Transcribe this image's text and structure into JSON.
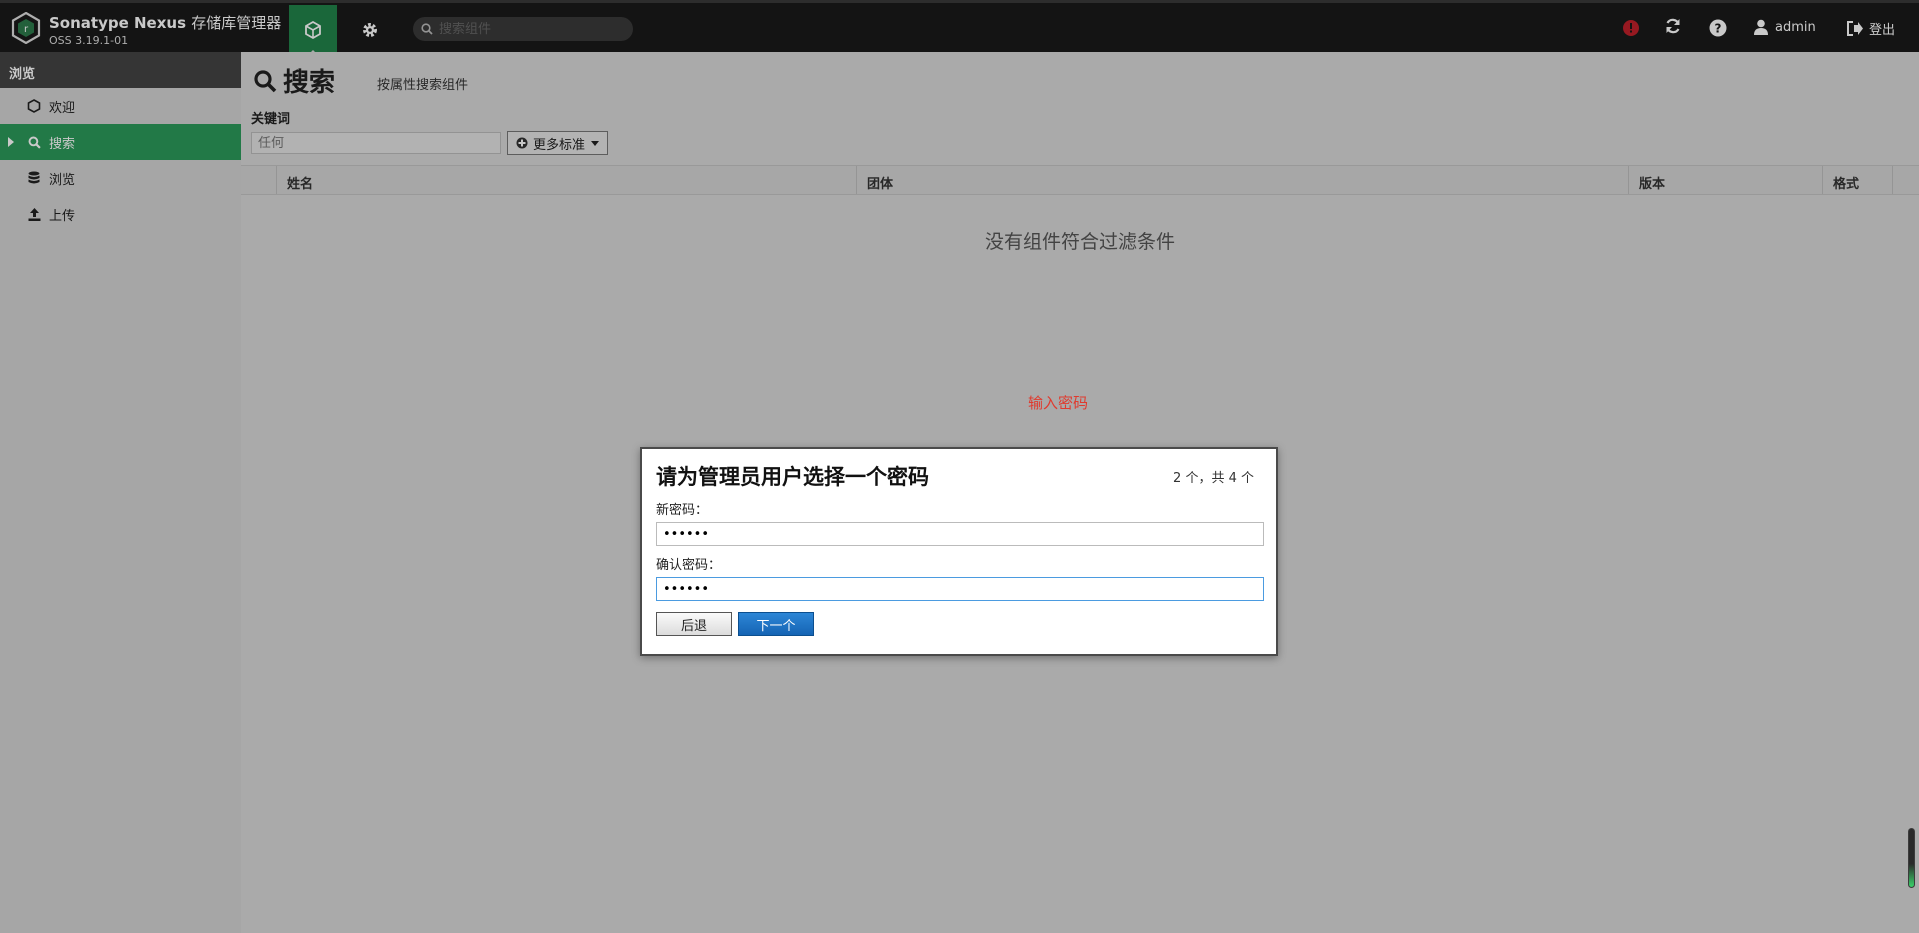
{
  "app": {
    "name": "Sonatype Nexus",
    "name_cn": "存储库管理器",
    "version": "OSS 3.19.1-01"
  },
  "topbar": {
    "search_placeholder": "搜索组件",
    "user": "admin",
    "logout": "登出"
  },
  "sidebar": {
    "header": "浏览",
    "items": [
      {
        "label": "欢迎",
        "icon": "hexagon-icon"
      },
      {
        "label": "搜索",
        "icon": "search-icon"
      },
      {
        "label": "浏览",
        "icon": "database-icon"
      },
      {
        "label": "上传",
        "icon": "upload-icon"
      }
    ]
  },
  "main": {
    "title": "搜索",
    "subtitle": "按属性搜索组件",
    "keyword_label": "关键词",
    "keyword_placeholder": "任何",
    "more_criteria": "更多标准",
    "columns": [
      "姓名",
      "团体",
      "版本",
      "格式"
    ],
    "empty_message": "没有组件符合过滤条件"
  },
  "overlay_hint": "输入密码",
  "dialog": {
    "title": "请为管理员用户选择一个密码",
    "step": "2 个，共 4 个",
    "new_password_label": "新密码：",
    "new_password_value": "••••••",
    "confirm_password_label": "确认密码：",
    "confirm_password_value": "••••••",
    "back_button": "后退",
    "next_button": "下一个"
  },
  "colors": {
    "accent_green": "#21834a",
    "active_item": "#2c9a5a",
    "hint_red": "#e03a2e",
    "primary_button": "#1564b4"
  }
}
